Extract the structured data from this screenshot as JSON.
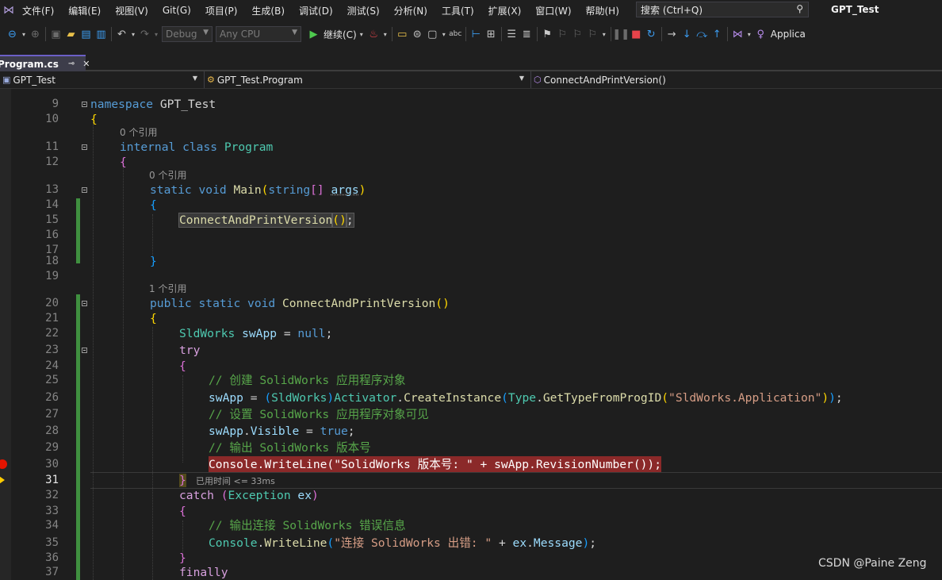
{
  "menubar": {
    "items": [
      "文件(F)",
      "编辑(E)",
      "视图(V)",
      "Git(G)",
      "项目(P)",
      "生成(B)",
      "调试(D)",
      "测试(S)",
      "分析(N)",
      "工具(T)",
      "扩展(X)",
      "窗口(W)",
      "帮助(H)"
    ],
    "search_placeholder": "搜索 (Ctrl+Q)",
    "window_title": "GPT_Test"
  },
  "toolbar": {
    "config": "Debug",
    "platform": "Any CPU",
    "continue_label": "继续(C)",
    "app_label": "Applica"
  },
  "tab": {
    "name": "Program.cs"
  },
  "navbar": {
    "project": "GPT_Test",
    "class": "GPT_Test.Program",
    "member": "ConnectAndPrintVersion()"
  },
  "editor": {
    "codelens": {
      "ref0_a": "0 个引用",
      "ref0_b": "0 个引用",
      "ref1": "1 个引用"
    },
    "elapsed": "已用时间 <= 33ms",
    "comments": {
      "c25": "// 创建 SolidWorks 应用程序对象",
      "c27": "// 设置 SolidWorks 应用程序对象可见",
      "c29": "// 输出 SolidWorks 版本号",
      "c34": "// 输出连接 SolidWorks 错误信息"
    },
    "strings": {
      "progid": "\"SldWorks.Application\"",
      "version": "\"SolidWorks 版本号: \"",
      "error": "\"连接 SolidWorks 出错: \""
    }
  },
  "watermark": "CSDN @Paine Zeng"
}
